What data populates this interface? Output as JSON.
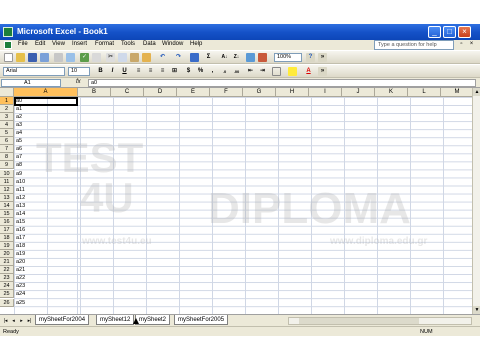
{
  "window": {
    "title": "Microsoft Excel - Book1"
  },
  "menu": {
    "items": [
      "File",
      "Edit",
      "View",
      "Insert",
      "Format",
      "Tools",
      "Data",
      "Window",
      "Help"
    ],
    "help_placeholder": "Type a question for help"
  },
  "toolbar": {
    "zoom": "100%",
    "font_name": "Arial",
    "font_size": "10"
  },
  "formula_bar": {
    "name_box": "A1",
    "fx": "fx",
    "content": "a0"
  },
  "columns": [
    "A",
    "B",
    "C",
    "D",
    "E",
    "F",
    "G",
    "H",
    "I",
    "J",
    "K",
    "L",
    "M"
  ],
  "rows": [
    "1",
    "2",
    "3",
    "4",
    "5",
    "6",
    "7",
    "8",
    "9",
    "10",
    "11",
    "12",
    "13",
    "14",
    "15",
    "16",
    "17",
    "18",
    "19",
    "20",
    "21",
    "22",
    "23",
    "24",
    "25",
    "26"
  ],
  "column_a_values": [
    "a0",
    "a1",
    "a2",
    "a3",
    "a4",
    "a5",
    "a6",
    "a7",
    "a8",
    "a9",
    "a10",
    "a11",
    "a12",
    "a13",
    "a14",
    "a15",
    "a16",
    "a17",
    "a18",
    "a19",
    "a20",
    "a21",
    "a22",
    "a23",
    "a24",
    "a25"
  ],
  "watermark": {
    "line1": "TEST",
    "line2": "4U",
    "brand": "DIPLOMA",
    "url1": "www.test4u.eu",
    "url2": "www.diploma.edu.gr"
  },
  "sheets": [
    "mySheetFor2004",
    "mySheet12",
    "mySheet2",
    "mySheetFor2005"
  ],
  "status": {
    "left": "Ready",
    "right": "NUM"
  },
  "colors": {
    "title_bar": "#1552c8",
    "selected_header": "#ffc05c",
    "chrome": "#ece9d8"
  }
}
